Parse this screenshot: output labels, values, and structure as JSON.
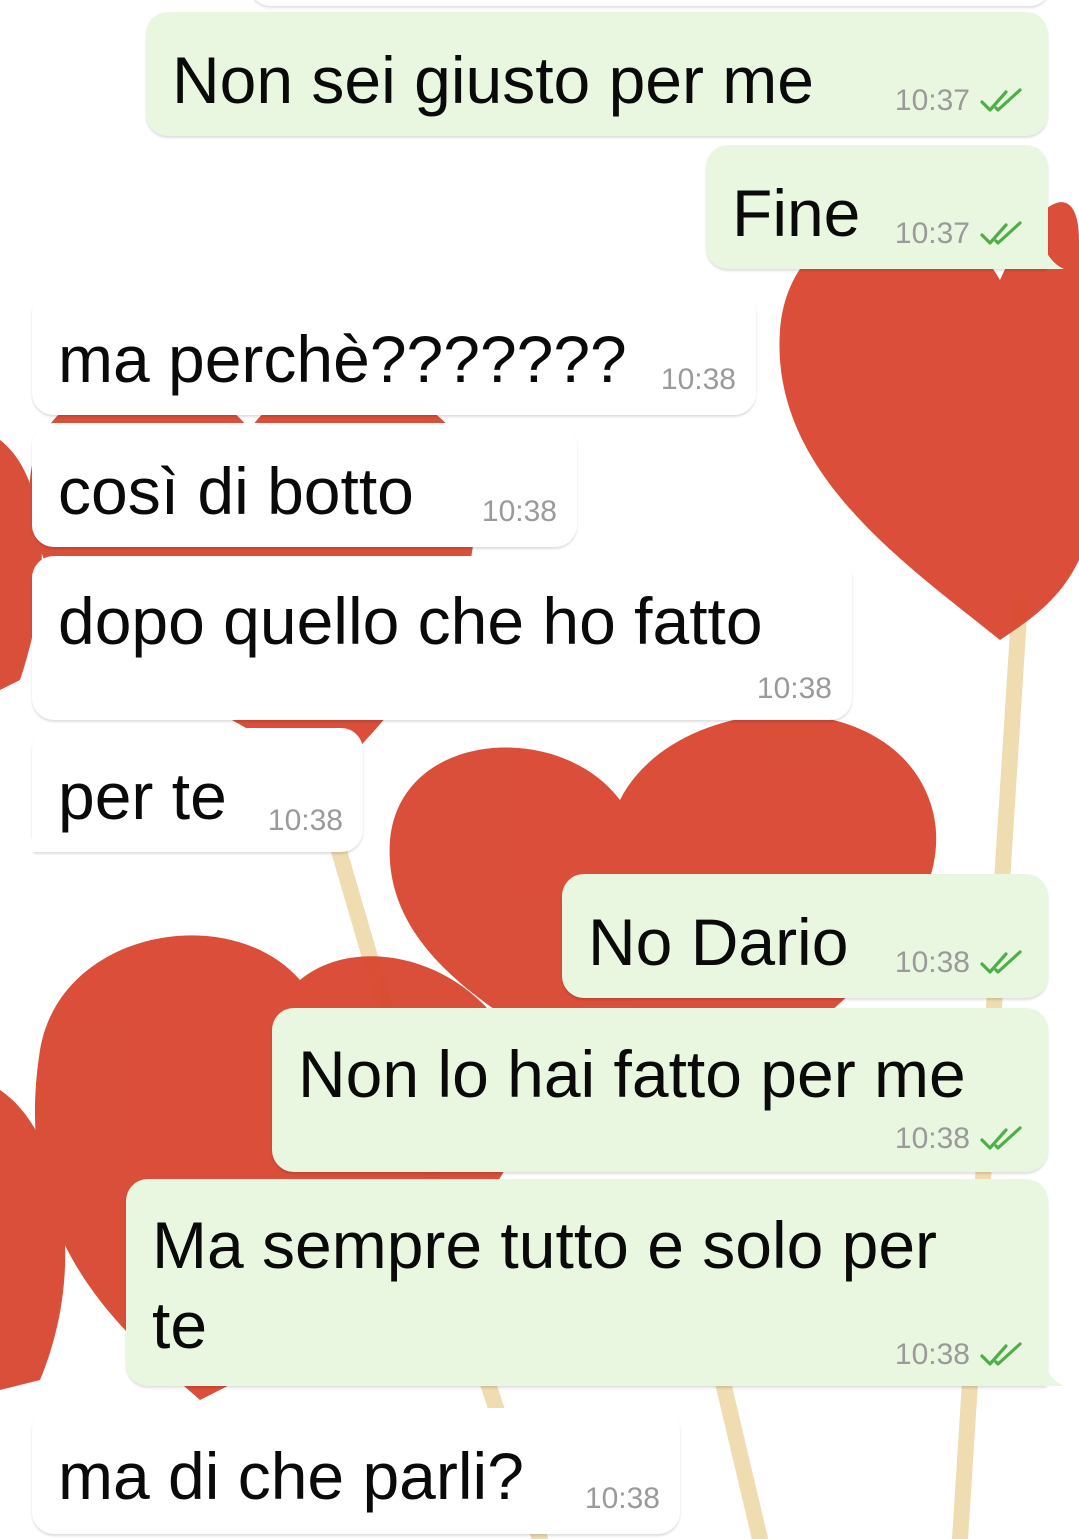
{
  "wallpaper": {
    "description_icon": "red-heart-lollipops",
    "accent": "#d9462f",
    "stick": "#efdcb0"
  },
  "colors": {
    "outgoing_bubble": "#e9f7e1",
    "incoming_bubble": "#ffffff",
    "tick": "#4fae4a",
    "time": "#9a9a9a"
  },
  "messages": [
    {
      "dir": "out",
      "text": "Non sei giusto per me",
      "time": "10:37",
      "read": true
    },
    {
      "dir": "out",
      "text": "Fine",
      "time": "10:37",
      "read": true
    },
    {
      "dir": "in",
      "text": "ma perchè???????",
      "time": "10:38"
    },
    {
      "dir": "in",
      "text": "così di botto",
      "time": "10:38"
    },
    {
      "dir": "in",
      "text": "dopo quello che ho fatto",
      "time": "10:38"
    },
    {
      "dir": "in",
      "text": "per te",
      "time": "10:38"
    },
    {
      "dir": "out",
      "text": "No Dario",
      "time": "10:38",
      "read": true
    },
    {
      "dir": "out",
      "text": "Non lo hai fatto per me",
      "time": "10:38",
      "read": true
    },
    {
      "dir": "out",
      "text": "Ma sempre tutto e solo per\nte",
      "time": "10:38",
      "read": true
    },
    {
      "dir": "in",
      "text": "ma di che parli?",
      "time": "10:38"
    }
  ]
}
